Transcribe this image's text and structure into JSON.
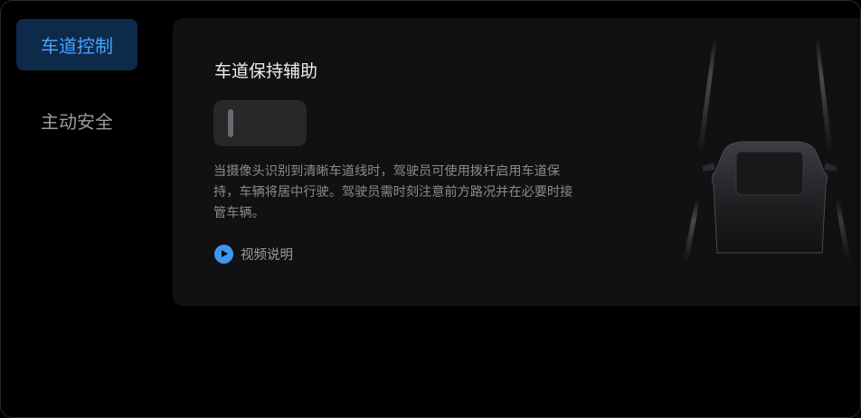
{
  "sidebar": {
    "items": [
      {
        "label": "车道控制",
        "active": true
      },
      {
        "label": "主动安全",
        "active": false
      }
    ]
  },
  "panel": {
    "title": "车道保持辅助",
    "toggle_state": "off",
    "description": "当摄像头识别到清晰车道线时，驾驶员可使用拨杆启用车道保持，车辆将居中行驶。驾驶员需时刻注意前方路况并在必要时接管车辆。",
    "video_link_label": "视频说明",
    "video_icon": "play-icon"
  },
  "colors": {
    "accent": "#47a3ff",
    "active_bg": "#0e2a4a",
    "card_bg": "#111113",
    "play_icon": "#3f97f0"
  }
}
